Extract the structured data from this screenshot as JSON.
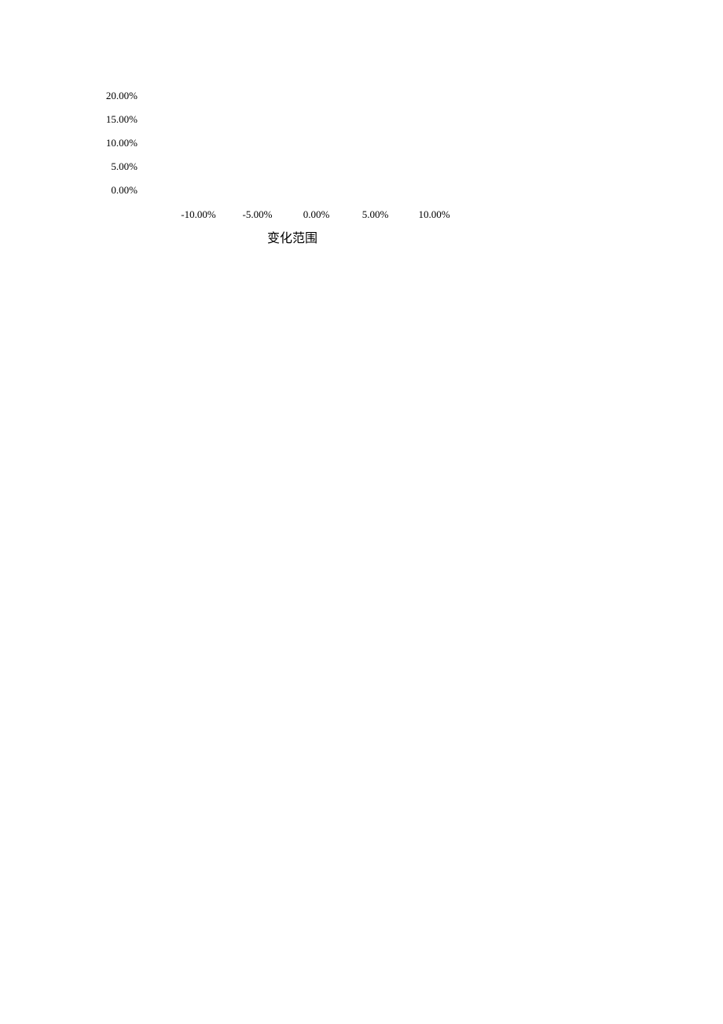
{
  "chart_data": {
    "type": "line",
    "categories": [
      "-10.00%",
      "-5.00%",
      "0.00%",
      "5.00%",
      "10.00%"
    ],
    "values": [],
    "title": "",
    "xlabel": "变化范围",
    "ylabel": "",
    "ylim": [
      0,
      20
    ],
    "y_ticks": [
      "20.00%",
      "15.00%",
      "10.00%",
      "5.00%",
      "0.00%"
    ],
    "x_ticks": [
      "-10.00%",
      "-5.00%",
      "0.00%",
      "5.00%",
      "10.00%"
    ]
  }
}
